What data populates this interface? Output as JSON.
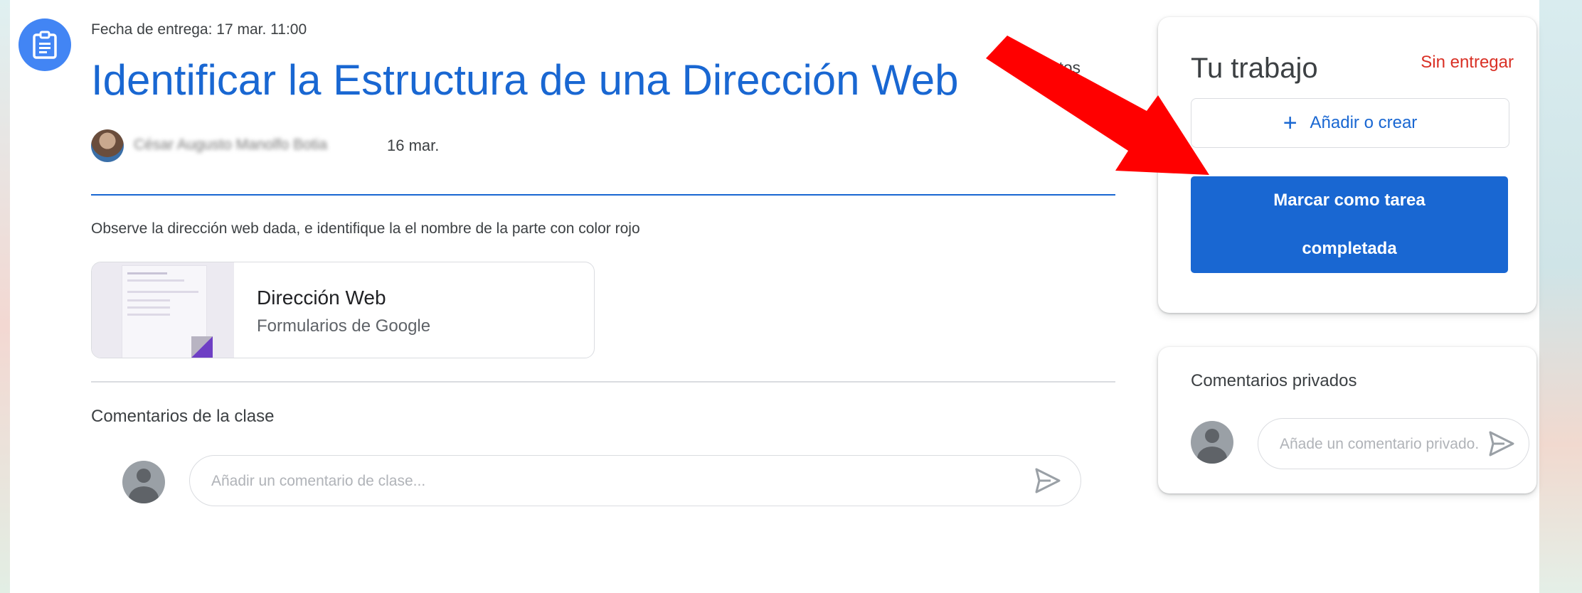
{
  "assignment": {
    "icon": "assignment-icon",
    "due_label": "Fecha de entrega: 17 mar. 11:00",
    "title": "Identificar la Estructura de una Dirección Web",
    "points": "puntos",
    "author": "César Augusto Manolfo Botia",
    "posted_date": "16 mar.",
    "description": "Observe la dirección web dada, e identifique la el nombre de la parte con color rojo"
  },
  "attachment": {
    "title": "Dirección Web",
    "subtitle": "Formularios de Google"
  },
  "class_comments": {
    "heading": "Comentarios de la clase",
    "placeholder": "Añadir un comentario de clase..."
  },
  "your_work": {
    "title": "Tu trabajo",
    "status": "Sin entregar",
    "add_label": "Añadir o crear",
    "mark_done_label": "Marcar como tarea completada"
  },
  "private_comments": {
    "heading": "Comentarios privados",
    "placeholder": "Añade un comentario privado..."
  },
  "colors": {
    "accent_blue": "#1967d2",
    "status_red": "#d93025",
    "annotation_arrow": "#ff0000"
  }
}
